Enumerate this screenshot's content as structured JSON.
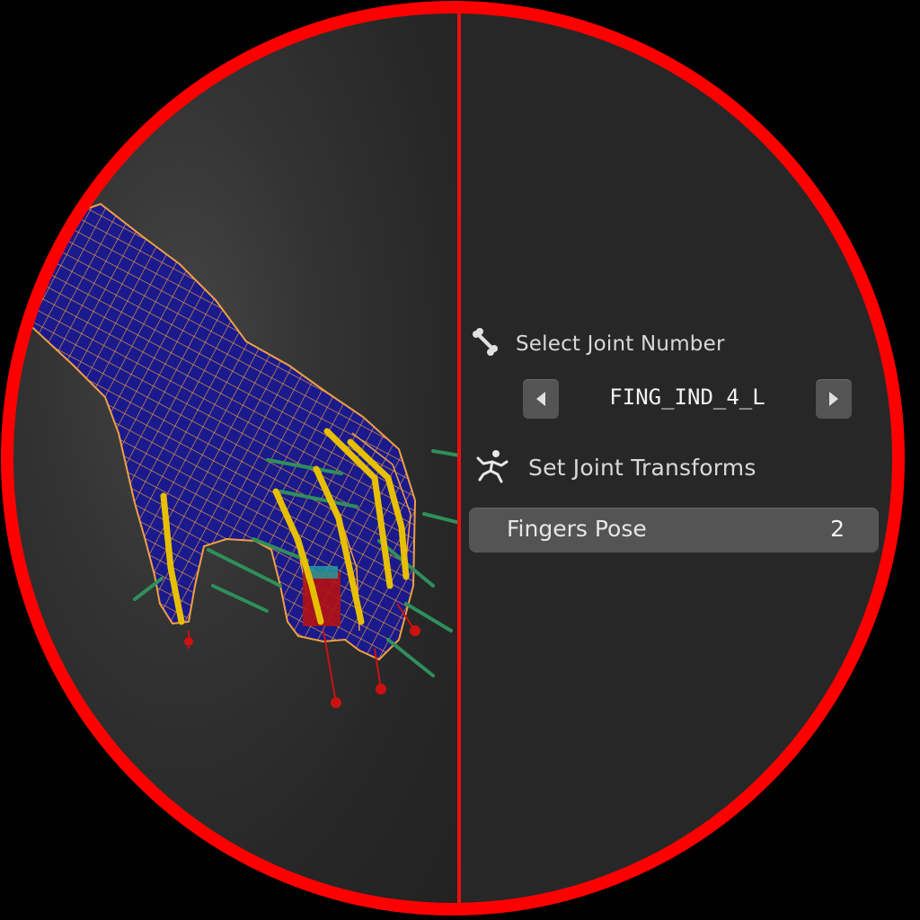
{
  "panel": {
    "select_joint_label": "Select Joint Number",
    "joint_name": "FING_IND_4_L",
    "set_transforms_label": "Set Joint Transforms",
    "fingers_pose_label": "Fingers Pose",
    "fingers_pose_value": "2"
  },
  "icons": {
    "bone": "bone-icon",
    "pose": "pose-figure-icon",
    "prev": "triangle-left-icon",
    "next": "triangle-right-icon"
  },
  "colors": {
    "ring": "#ff0000",
    "mesh_fill": "#1a1a88",
    "wire": "#f0a040",
    "bone": "#e6c000",
    "bone_red": "#cc1111",
    "bone_green": "#2f8f5a"
  }
}
